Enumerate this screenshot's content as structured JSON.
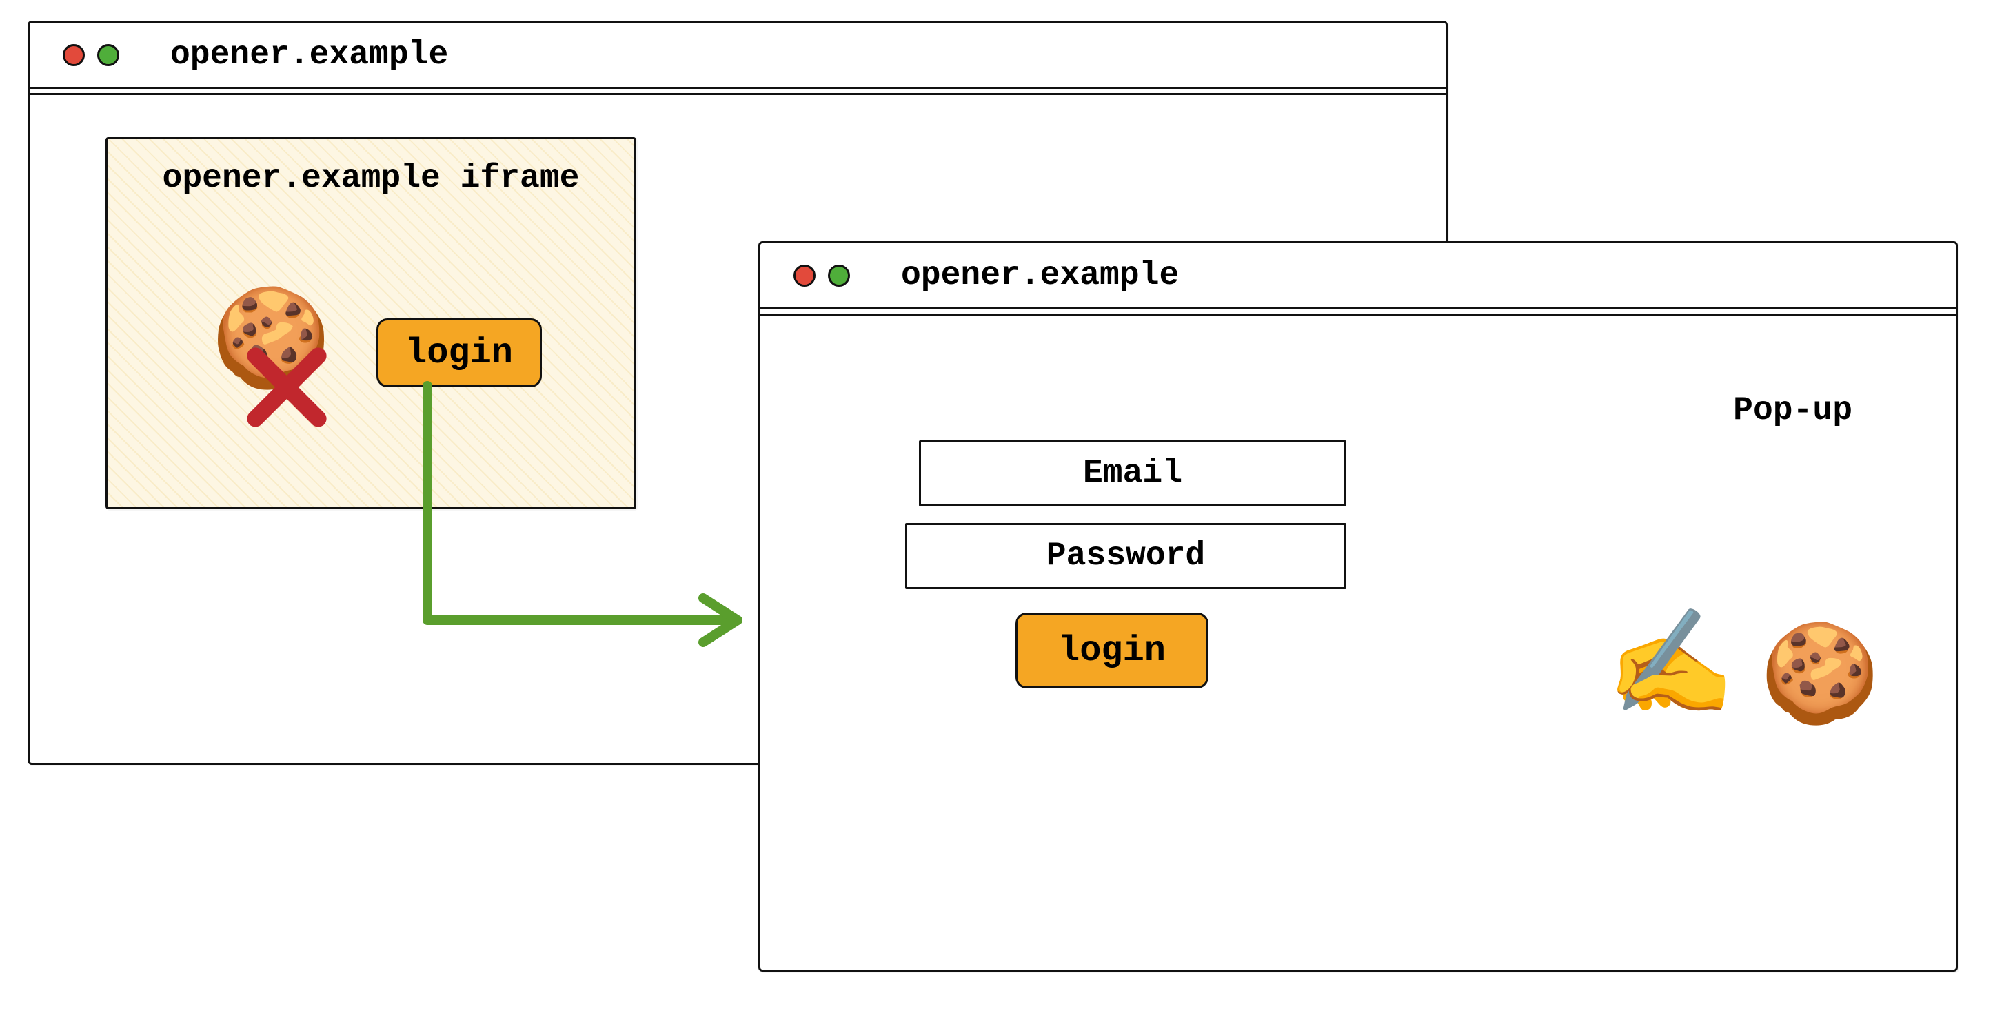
{
  "window_a": {
    "title": "opener.example",
    "iframe": {
      "title": "opener.example iframe",
      "cookie_icon": "🍪",
      "cookie_blocked": true,
      "login_button": "login"
    }
  },
  "window_b": {
    "title": "opener.example",
    "popup_label": "Pop-up",
    "email_placeholder": "Email",
    "password_placeholder": "Password",
    "login_button": "login",
    "writing_icon": "✍️",
    "cookie_icon": "🍪"
  },
  "colors": {
    "button": "#f5a623",
    "arrow": "#5a9e2d",
    "cross": "#c1272d"
  }
}
